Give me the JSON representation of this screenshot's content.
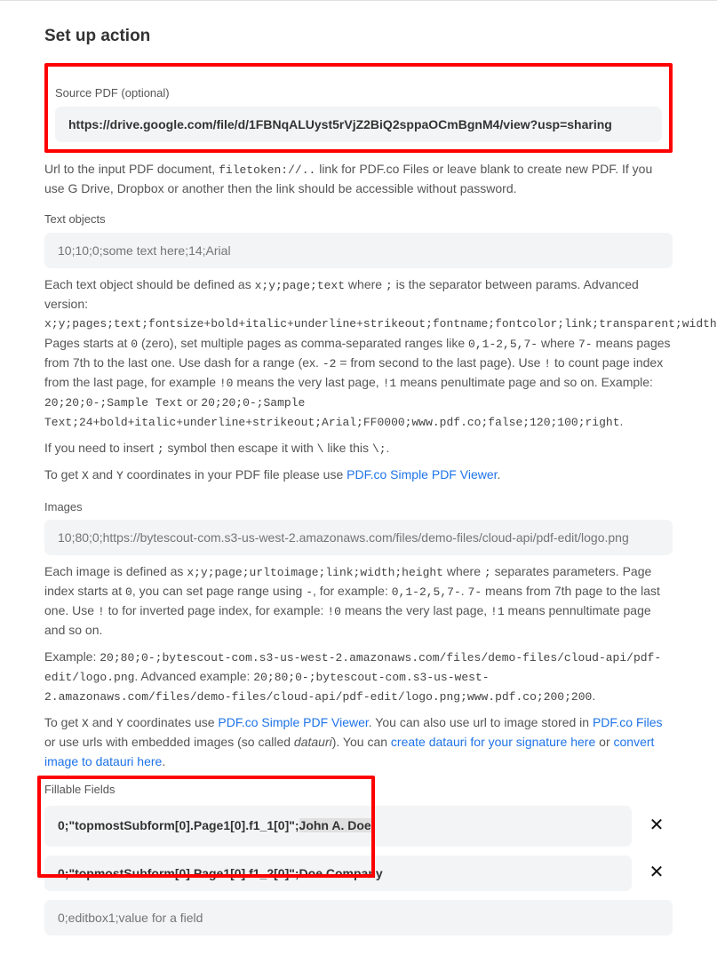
{
  "title": "Set up action",
  "source_pdf": {
    "label": "Source PDF (optional)",
    "value": "https://drive.google.com/file/d/1FBNqALUyst5rVjZ2BiQ2sppaOCmBgnM4/view?usp=sharing",
    "help_pre": "Url to the input PDF document, ",
    "help_code1": "filetoken://..",
    "help_post": " link for PDF.co Files or leave blank to create new PDF. If you use G Drive, Dropbox or another then the link should be accessible without password."
  },
  "text_objects": {
    "label": "Text objects",
    "placeholder": "10;10;0;some text here;14;Arial",
    "help1_a": "Each text object should be defined as ",
    "help1_code_a": "x;y;page;text",
    "help1_b": " where ",
    "help1_code_b": ";",
    "help1_c": " is the separator between params. Advanced version: ",
    "help1_code_c": "x;y;pages;text;fontsize+bold+italic+underline+strikeout;fontname;fontcolor;link;transparent;width;height;alig",
    "help1_d": " Pages starts at ",
    "help1_code_d": "0",
    "help1_e": " (zero), set multiple pages as comma-separated ranges like ",
    "help1_code_e": "0,1-2,5,7-",
    "help1_f": " where ",
    "help1_code_f": "7-",
    "help1_g": " means pages from 7th to the last one. Use dash for a range (ex. ",
    "help1_code_g": "-2",
    "help1_h": " = from second to the last page). Use ",
    "help1_code_h": "!",
    "help1_i": " to count page index from the last page, for example ",
    "help1_code_i": "!0",
    "help1_j": " means the very last page, ",
    "help1_code_j": "!1",
    "help1_k": " means penultimate page and so on. Example: ",
    "help1_code_k": "20;20;0-;Sample Text",
    "help1_l": " or ",
    "help1_code_l": "20;20;0-;Sample Text;24+bold+italic+underline+strikeout;Arial;FF0000;www.pdf.co;false;120;100;right",
    "help1_m": ".",
    "help2_a": "If you need to insert ",
    "help2_code_a": ";",
    "help2_b": " symbol then escape it with ",
    "help2_code_b": "\\",
    "help2_c": " like this ",
    "help2_code_c": "\\;",
    "help2_d": ".",
    "help3_a": "To get ",
    "help3_code_a": "X",
    "help3_b": " and ",
    "help3_code_b": "Y",
    "help3_c": " coordinates in your PDF file please use ",
    "help3_link": "PDF.co Simple PDF Viewer",
    "help3_d": "."
  },
  "images": {
    "label": "Images",
    "placeholder": "10;80;0;https://bytescout-com.s3-us-west-2.amazonaws.com/files/demo-files/cloud-api/pdf-edit/logo.png",
    "h1_a": "Each image is defined as ",
    "h1_code_a": "x;y;page;urltoimage;link;width;height",
    "h1_b": " where ",
    "h1_code_b": ";",
    "h1_c": " separates parameters. Page index starts at ",
    "h1_code_c": "0",
    "h1_d": ", you can set page range using ",
    "h1_code_d": "-",
    "h1_e": ", for example: ",
    "h1_code_e": "0,1-2,5,7-",
    "h1_f": ". ",
    "h1_code_f": "7-",
    "h1_g": " means from 7th page to the last one. Use ",
    "h1_code_g": "!",
    "h1_h": " to for inverted page index, for example: ",
    "h1_code_h": "!0",
    "h1_i": " means the very last page, ",
    "h1_code_i": "!1",
    "h1_j": " means pennultimate page and so on.",
    "h2_a": "Example: ",
    "h2_code_a": "20;80;0-;bytescout-com.s3-us-west-2.amazonaws.com/files/demo-files/cloud-api/pdf-edit/logo.png",
    "h2_b": ". Advanced example: ",
    "h2_code_b": "20;80;0-;bytescout-com.s3-us-west-2.amazonaws.com/files/demo-files/cloud-api/pdf-edit/logo.png;www.pdf.co;200;200",
    "h2_c": ".",
    "h3_a": "To get ",
    "h3_code_a": "X",
    "h3_b": " and ",
    "h3_code_b": "Y",
    "h3_c": " coordinates use ",
    "h3_link1": "PDF.co Simple PDF Viewer",
    "h3_d": ". You can also use url to image stored in ",
    "h3_link2": "PDF.co Files",
    "h3_e": " or use urls with embedded images (so called ",
    "h3_em": "datauri",
    "h3_f": "). You can ",
    "h3_link3": "create datauri for your signature here",
    "h3_g": " or ",
    "h3_link4": "convert image to datauri here",
    "h3_h": "."
  },
  "fillable": {
    "label": "Fillable Fields",
    "rows": {
      "r0": {
        "pre": "0;\"topmostSubform[0].Page1[0].f1_1[0]\";",
        "hl": "John A. Doe"
      },
      "r1": {
        "value": "0;\"topmostSubform[0].Page1[0].f1_2[0]\";Doe Company"
      }
    },
    "placeholder": "0;editbox1;value for a field"
  },
  "icons": {
    "close": "✕"
  }
}
